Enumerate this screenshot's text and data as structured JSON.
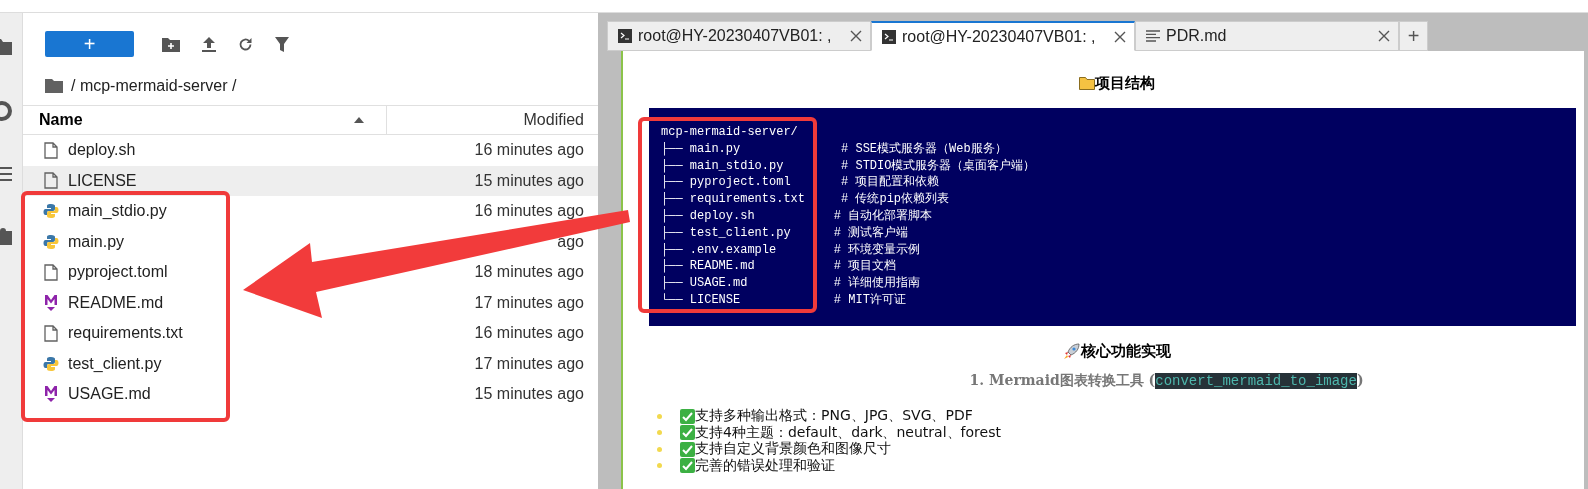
{
  "file_browser": {
    "new_button": "+",
    "breadcrumb": "/ mcp-mermaid-server /",
    "columns": [
      "Name",
      "Modified"
    ],
    "files": [
      {
        "name": "deploy.sh",
        "modified": "16 minutes ago",
        "kind": "file",
        "selected": false
      },
      {
        "name": "LICENSE",
        "modified": "15 minutes ago",
        "kind": "file",
        "selected": true
      },
      {
        "name": "main_stdio.py",
        "modified": "16 minutes ago",
        "kind": "python",
        "selected": false
      },
      {
        "name": "main.py",
        "modified": "ago",
        "kind": "python",
        "selected": false
      },
      {
        "name": "pyproject.toml",
        "modified": "18 minutes ago",
        "kind": "file",
        "selected": false
      },
      {
        "name": "README.md",
        "modified": "17 minutes ago",
        "kind": "markdown",
        "selected": false
      },
      {
        "name": "requirements.txt",
        "modified": "16 minutes ago",
        "kind": "file",
        "selected": false
      },
      {
        "name": "test_client.py",
        "modified": "17 minutes ago",
        "kind": "python",
        "selected": false
      },
      {
        "name": "USAGE.md",
        "modified": "15 minutes ago",
        "kind": "markdown",
        "selected": false
      }
    ]
  },
  "tabs": [
    {
      "title": "root@HY-20230407VB01: ,",
      "kind": "terminal",
      "selected": false
    },
    {
      "title": "root@HY-20230407VB01: ,",
      "kind": "terminal",
      "selected": true
    },
    {
      "title": "PDR.md",
      "kind": "markdown",
      "selected": false
    }
  ],
  "new_tab": "+",
  "document": {
    "section_1": {
      "title": "项目结构"
    },
    "code_lines": [
      "mcp-mermaid-server/",
      "├── main.py              # SSE模式服务器（Web服务）",
      "├── main_stdio.py        # STDIO模式服务器（桌面客户端）",
      "├── pyproject.toml       # 项目配置和依赖",
      "├── requirements.txt     # 传统pip依赖列表",
      "├── deploy.sh           # 自动化部署脚本",
      "├── test_client.py      # 测试客户端",
      "├── .env.example        # 环境变量示例",
      "├── README.md           # 项目文档",
      "├── USAGE.md            # 详细使用指南",
      "└── LICENSE             # MIT许可证"
    ],
    "section_2": {
      "title": "核心功能实现"
    },
    "subheading": {
      "prefix": "1. Mermaid图表转换工具 (",
      "code": "convert_mermaid_to_image",
      "suffix": ")"
    },
    "bullets": [
      "支持多种输出格式：PNG、JPG、SVG、PDF",
      "支持4种主题：default、dark、neutral、forest",
      "支持自定义背景颜色和图像尺寸",
      "完善的错误处理和验证"
    ]
  }
}
